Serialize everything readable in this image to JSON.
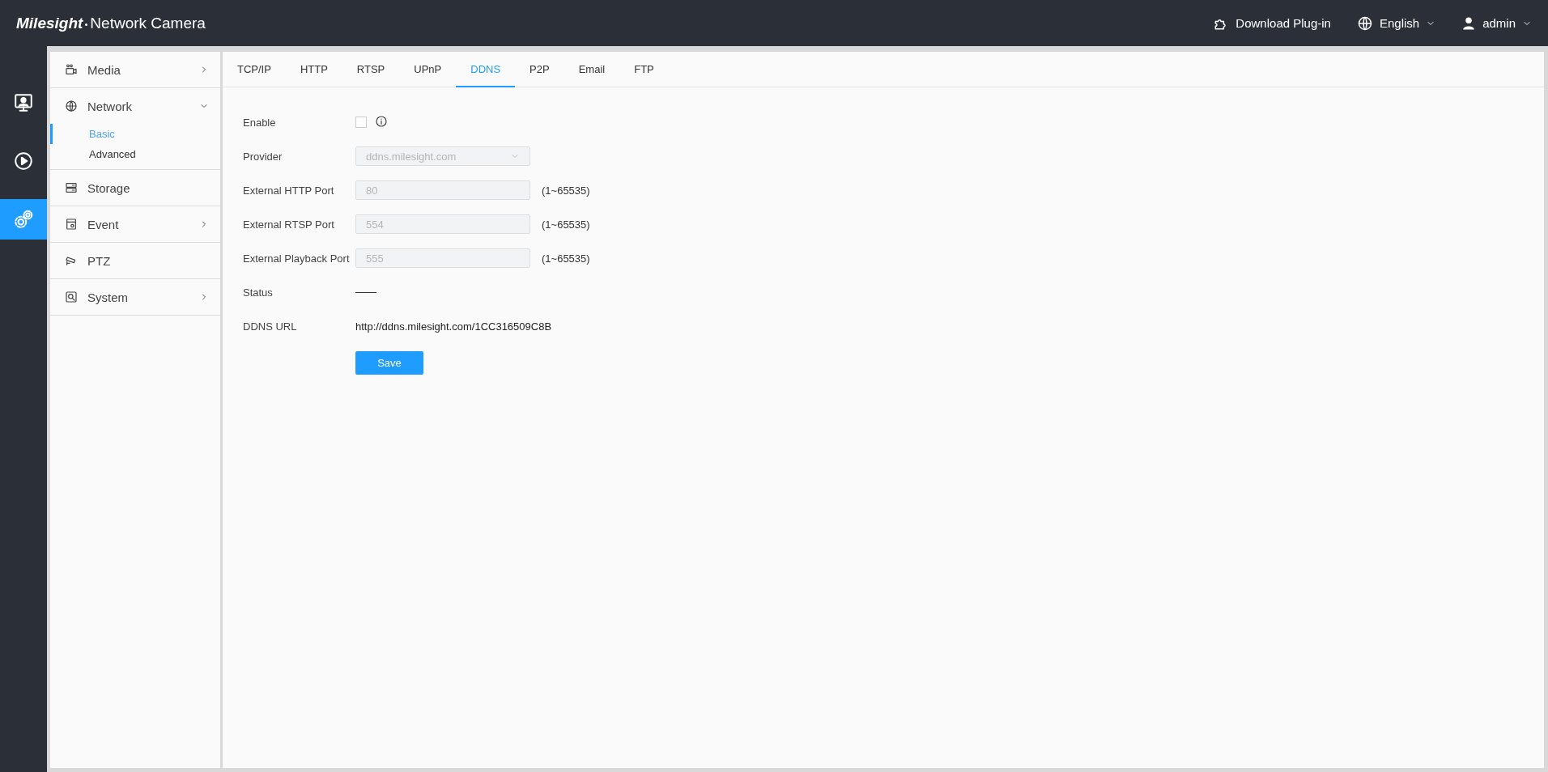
{
  "header": {
    "logo": "Milesight",
    "title": "Network Camera",
    "actions": [
      {
        "kind": "plugin",
        "label": "Download Plug-in"
      },
      {
        "kind": "language",
        "label": "English"
      },
      {
        "kind": "user",
        "label": "admin"
      }
    ]
  },
  "rail": [
    {
      "kind": "live",
      "selected": false
    },
    {
      "kind": "playback",
      "selected": false
    },
    {
      "kind": "settings",
      "selected": true
    }
  ],
  "menu": [
    {
      "kind": "group",
      "label": "Media",
      "expanded": false
    },
    {
      "kind": "group",
      "label": "Network",
      "expanded": true,
      "children": [
        {
          "label": "Basic",
          "selected": true
        },
        {
          "label": "Advanced",
          "selected": false
        }
      ]
    },
    {
      "kind": "page",
      "label": "Storage"
    },
    {
      "kind": "group",
      "label": "Event",
      "expanded": false
    },
    {
      "kind": "page",
      "label": "PTZ"
    },
    {
      "kind": "group",
      "label": "System",
      "expanded": false
    }
  ],
  "tabs": [
    {
      "label": "TCP/IP",
      "selected": false
    },
    {
      "label": "HTTP",
      "selected": false
    },
    {
      "label": "RTSP",
      "selected": false
    },
    {
      "label": "UPnP",
      "selected": false
    },
    {
      "label": "DDNS",
      "selected": true
    },
    {
      "label": "P2P",
      "selected": false
    },
    {
      "label": "Email",
      "selected": false
    },
    {
      "label": "FTP",
      "selected": false
    }
  ],
  "form": [
    {
      "kind": "checkbox",
      "label": "Enable",
      "checked": false
    },
    {
      "kind": "select",
      "label": "Provider",
      "value": "ddns.milesight.com",
      "disabled": true
    },
    {
      "kind": "input",
      "label": "External HTTP Port",
      "value": "80",
      "disabled": true,
      "hint": "(1~65535)"
    },
    {
      "kind": "input",
      "label": "External RTSP Port",
      "value": "554",
      "disabled": true,
      "hint": "(1~65535)"
    },
    {
      "kind": "input",
      "label": "External Playback Port",
      "value": "555",
      "disabled": true,
      "hint": "(1~65535)"
    },
    {
      "kind": "empty",
      "label": "Status"
    },
    {
      "kind": "text",
      "label": "DDNS URL",
      "value": "http://ddns.milesight.com/1CC316509C8B"
    }
  ],
  "save_button": "Save"
}
